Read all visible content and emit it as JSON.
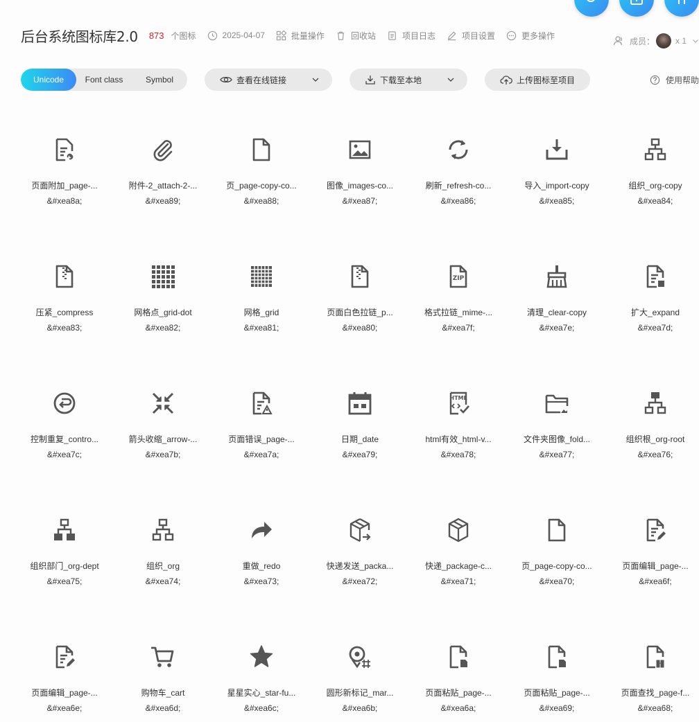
{
  "project": {
    "title": "后台系统图标库2.0",
    "icon_count": "873",
    "icon_unit": "个图标",
    "date": "2025-04-07",
    "actions": [
      "批量操作",
      "回收站",
      "项目日志",
      "项目设置",
      "更多操作"
    ],
    "members_label": "成员：",
    "members_count": "x 1"
  },
  "toolbar": {
    "tabs": [
      "Unicode",
      "Font class",
      "Symbol"
    ],
    "online_link": "查看在线链接",
    "download": "下载至本地",
    "upload": "上传图标至项目",
    "help": "使用帮助"
  },
  "colors": {
    "accent_start": "#20d6ea",
    "accent_end": "#3b8af5",
    "count": "#d4212a",
    "icon": "#555555"
  },
  "icons": [
    {
      "name": "页面附加_page-...",
      "code": "&#xea8a;",
      "glyph": "page-attach-icon"
    },
    {
      "name": "附件-2_attach-2-...",
      "code": "&#xea89;",
      "glyph": "paperclip-icon"
    },
    {
      "name": "页_page-copy-co...",
      "code": "&#xea88;",
      "glyph": "page-icon"
    },
    {
      "name": "图像_images-co...",
      "code": "&#xea87;",
      "glyph": "image-icon"
    },
    {
      "name": "刷新_refresh-co...",
      "code": "&#xea86;",
      "glyph": "refresh-icon"
    },
    {
      "name": "导入_import-copy",
      "code": "&#xea85;",
      "glyph": "import-icon"
    },
    {
      "name": "组织_org-copy",
      "code": "&#xea84;",
      "glyph": "org-outline-icon"
    },
    {
      "name": "压紧_compress",
      "code": "&#xea83;",
      "glyph": "compress-file-icon"
    },
    {
      "name": "网格点_grid-dot",
      "code": "&#xea82;",
      "glyph": "grid-dot-icon"
    },
    {
      "name": "网格_grid",
      "code": "&#xea81;",
      "glyph": "grid-icon"
    },
    {
      "name": "页面白色拉链_p...",
      "code": "&#xea80;",
      "glyph": "page-zipper-icon"
    },
    {
      "name": "格式拉链_mime-...",
      "code": "&#xea7f;",
      "glyph": "zip-file-icon"
    },
    {
      "name": "清理_clear-copy",
      "code": "&#xea7e;",
      "glyph": "broom-icon"
    },
    {
      "name": "扩大_expand",
      "code": "&#xea7d;",
      "glyph": "page-expand-icon"
    },
    {
      "name": "控制重复_contro...",
      "code": "&#xea7c;",
      "glyph": "repeat-circle-icon"
    },
    {
      "name": "箭头收缩_arrow-...",
      "code": "&#xea7b;",
      "glyph": "arrows-shrink-icon"
    },
    {
      "name": "页面错误_page-...",
      "code": "&#xea7a;",
      "glyph": "page-error-icon"
    },
    {
      "name": "日期_date",
      "code": "&#xea79;",
      "glyph": "calendar-icon"
    },
    {
      "name": "html有效_html-v...",
      "code": "&#xea78;",
      "glyph": "html-valid-icon"
    },
    {
      "name": "文件夹图像_fold...",
      "code": "&#xea77;",
      "glyph": "folder-image-icon"
    },
    {
      "name": "组织根_org-root",
      "code": "&#xea76;",
      "glyph": "org-root-icon"
    },
    {
      "name": "组织部门_org-dept",
      "code": "&#xea75;",
      "glyph": "org-dept-icon"
    },
    {
      "name": "组织_org",
      "code": "&#xea74;",
      "glyph": "org-icon"
    },
    {
      "name": "重做_redo",
      "code": "&#xea73;",
      "glyph": "redo-icon"
    },
    {
      "name": "快递发送_packa...",
      "code": "&#xea72;",
      "glyph": "package-send-icon"
    },
    {
      "name": "快递_package-c...",
      "code": "&#xea71;",
      "glyph": "package-icon"
    },
    {
      "name": "页_page-copy-co...",
      "code": "&#xea70;",
      "glyph": "page-icon"
    },
    {
      "name": "页面编辑_page-...",
      "code": "&#xea6f;",
      "glyph": "page-edit-icon"
    },
    {
      "name": "页面编辑_page-...",
      "code": "&#xea6e;",
      "glyph": "page-edit-icon"
    },
    {
      "name": "购物车_cart",
      "code": "&#xea6d;",
      "glyph": "cart-icon"
    },
    {
      "name": "星星实心_star-fu...",
      "code": "&#xea6c;",
      "glyph": "star-icon"
    },
    {
      "name": "圆形新标记_mar...",
      "code": "&#xea6b;",
      "glyph": "marker-new-icon"
    },
    {
      "name": "页面粘贴_page-...",
      "code": "&#xea6a;",
      "glyph": "page-paste-icon"
    },
    {
      "name": "页面粘贴_page-...",
      "code": "&#xea69;",
      "glyph": "page-paste-icon"
    },
    {
      "name": "页面查找_page-f...",
      "code": "&#xea68;",
      "glyph": "page-find-icon"
    }
  ]
}
